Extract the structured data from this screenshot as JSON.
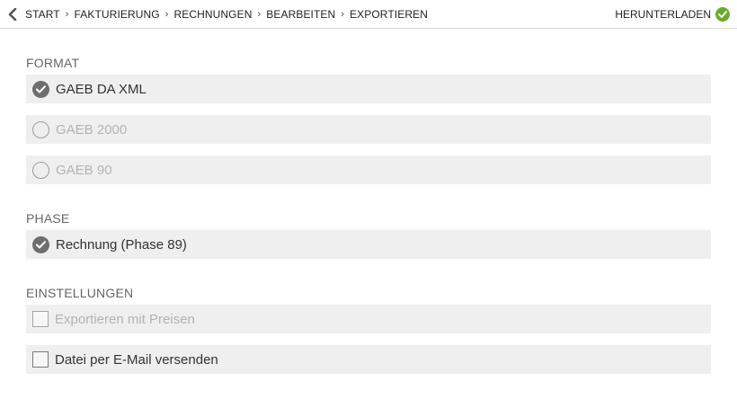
{
  "breadcrumb": {
    "items": [
      "START",
      "FAKTURIERUNG",
      "RECHNUNGEN",
      "BEARBEITEN",
      "EXPORTIEREN"
    ],
    "separator": "›"
  },
  "actions": {
    "download_label": "HERUNTERLADEN"
  },
  "format": {
    "title": "FORMAT",
    "options": [
      {
        "label": "GAEB DA XML",
        "selected": true,
        "enabled": true
      },
      {
        "label": "GAEB 2000",
        "selected": false,
        "enabled": false
      },
      {
        "label": "GAEB 90",
        "selected": false,
        "enabled": false
      }
    ]
  },
  "phase": {
    "title": "PHASE",
    "options": [
      {
        "label": "Rechnung (Phase 89)",
        "selected": true,
        "enabled": true
      }
    ]
  },
  "settings": {
    "title": "EINSTELLUNGEN",
    "options": [
      {
        "label": "Exportieren mit Preisen",
        "checked": false,
        "enabled": false
      },
      {
        "label": "Datei per E-Mail versenden",
        "checked": false,
        "enabled": true
      }
    ]
  },
  "colors": {
    "accent_green": "#6aab2e",
    "row_background": "#efefef",
    "disabled_text": "#b3b3b3"
  }
}
